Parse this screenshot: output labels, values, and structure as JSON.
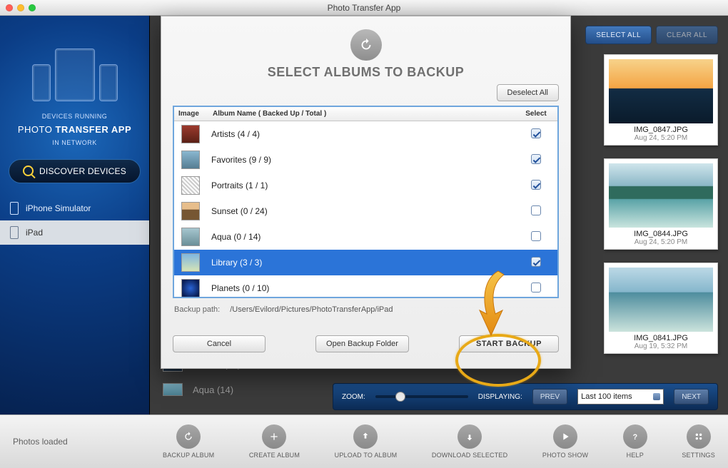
{
  "window": {
    "title": "Photo Transfer App"
  },
  "sidebar": {
    "caption_top": "DEVICES RUNNING",
    "caption_mid_left": "PHOTO ",
    "caption_mid_bold": "TRANSFER APP",
    "caption_bottom": "IN NETWORK",
    "discover_label": "DISCOVER DEVICES",
    "devices": [
      {
        "name": "iPhone Simulator",
        "selected": false
      },
      {
        "name": "iPad",
        "selected": true
      }
    ]
  },
  "top_buttons": {
    "select_all": "SELECT ALL",
    "clear_all": "CLEAR ALL"
  },
  "photos": [
    {
      "name": "IMG_0847.JPG",
      "date": "Aug 24, 5:20 PM",
      "thumb": "t-sunset"
    },
    {
      "name": "IMG_0844.JPG",
      "date": "Aug 24, 5:20 PM",
      "thumb": "t-beach1"
    },
    {
      "name": "IMG_0841.JPG",
      "date": "Aug 19, 5:32 PM",
      "thumb": "t-beach2"
    }
  ],
  "bg_rows": {
    "sunset": "Sunset (24)",
    "aqua": "Aqua (14)"
  },
  "zoom": {
    "label": "ZOOM:",
    "displaying_label": "DISPLAYING:",
    "prev": "PREV",
    "next": "NEXT",
    "select_value": "Last 100 items"
  },
  "status": {
    "text": "Photos loaded"
  },
  "toolbar": {
    "backup": "BACKUP ALBUM",
    "create": "CREATE ALBUM",
    "upload": "UPLOAD TO ALBUM",
    "download": "DOWNLOAD SELECTED",
    "show": "PHOTO SHOW",
    "help": "HELP",
    "settings": "SETTINGS"
  },
  "dialog": {
    "title": "SELECT ALBUMS TO BACKUP",
    "deselect": "Deselect All",
    "headers": {
      "image": "Image",
      "name": "Album Name ( Backed Up / Total )",
      "select": "Select"
    },
    "rows": [
      {
        "name": "Artists (4 / 4)",
        "checked": true,
        "thumb": "th-artists",
        "selected": false
      },
      {
        "name": "Favorites (9 / 9)",
        "checked": true,
        "thumb": "th-fav",
        "selected": false
      },
      {
        "name": "Portraits (1 / 1)",
        "checked": true,
        "thumb": "th-port",
        "selected": false
      },
      {
        "name": "Sunset (0 / 24)",
        "checked": false,
        "thumb": "th-sunset",
        "selected": false
      },
      {
        "name": "Aqua (0 / 14)",
        "checked": false,
        "thumb": "th-aqua",
        "selected": false
      },
      {
        "name": "Library (3 / 3)",
        "checked": true,
        "thumb": "th-lib",
        "selected": true
      },
      {
        "name": "Planets (0 / 10)",
        "checked": false,
        "thumb": "th-plan",
        "selected": false
      }
    ],
    "backup_path_label": "Backup path:",
    "backup_path_value": "/Users/Evilord/Pictures/PhotoTransferApp/iPad",
    "cancel": "Cancel",
    "open_folder": "Open Backup Folder",
    "start_backup": "START BACKUP"
  }
}
